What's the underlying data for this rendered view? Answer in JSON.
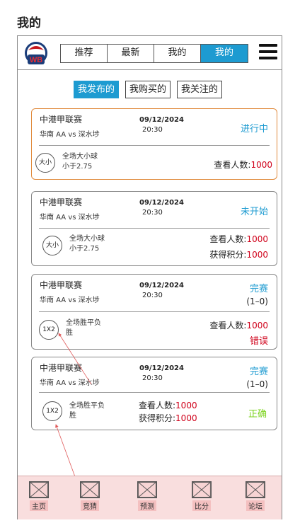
{
  "page_title": "我的",
  "logo_text": "WB",
  "top_tabs": [
    {
      "label": "推荐"
    },
    {
      "label": "最新"
    },
    {
      "label": "我的"
    },
    {
      "label": "我的"
    }
  ],
  "sub_tabs": [
    {
      "label": "我发布的"
    },
    {
      "label": "我购买的"
    },
    {
      "label": "我关注的"
    }
  ],
  "cards": [
    {
      "league": "中港甲联赛",
      "teams": "华南 AA vs 深水埗",
      "date": "09/12/2024",
      "time": "20:30",
      "status": "进行中",
      "badge": "大小",
      "desc_line1": "全场大小球",
      "desc_line2": "小于2.75",
      "views_label": "查看人数:",
      "views": "1000"
    },
    {
      "league": "中港甲联赛",
      "teams": "华南 AA vs 深水埗",
      "date": "09/12/2024",
      "time": "20:30",
      "status": "未开始",
      "badge": "大小",
      "desc_line1": "全场大小球",
      "desc_line2": "小于2.75",
      "views_label": "查看人数:",
      "views": "1000",
      "points_label": "获得积分:",
      "points": "1000"
    },
    {
      "league": "中港甲联赛",
      "teams": "华南 AA vs 深水埗",
      "date": "09/12/2024",
      "time": "20:30",
      "status": "完赛",
      "score": "(1–0)",
      "badge": "1X2",
      "desc_line1": "全场胜平负",
      "desc_line2": "胜",
      "views_label": "查看人数:",
      "views": "1000",
      "result": "错误"
    },
    {
      "league": "中港甲联赛",
      "teams": "华南 AA vs 深水埗",
      "date": "09/12/2024",
      "time": "20:30",
      "status": "完赛",
      "score": "(1–0)",
      "badge": "1X2",
      "desc_line1": "全场胜平负",
      "desc_line2": "胜",
      "views_label": "查看人数:",
      "views": "1000",
      "points_label": "获得积分:",
      "points": "1000",
      "result": "正确"
    }
  ],
  "bottom_nav": [
    {
      "label": "主页"
    },
    {
      "label": "竞猜"
    },
    {
      "label": "预测"
    },
    {
      "label": "比分"
    },
    {
      "label": "论坛"
    }
  ],
  "colors": {
    "accent": "#1d9bd1",
    "number_red": "#d0021b",
    "wrong_red": "#d0021b",
    "correct_green": "#7ed321",
    "selected_border": "#e08a3c",
    "nav_bg": "#f9dede"
  }
}
